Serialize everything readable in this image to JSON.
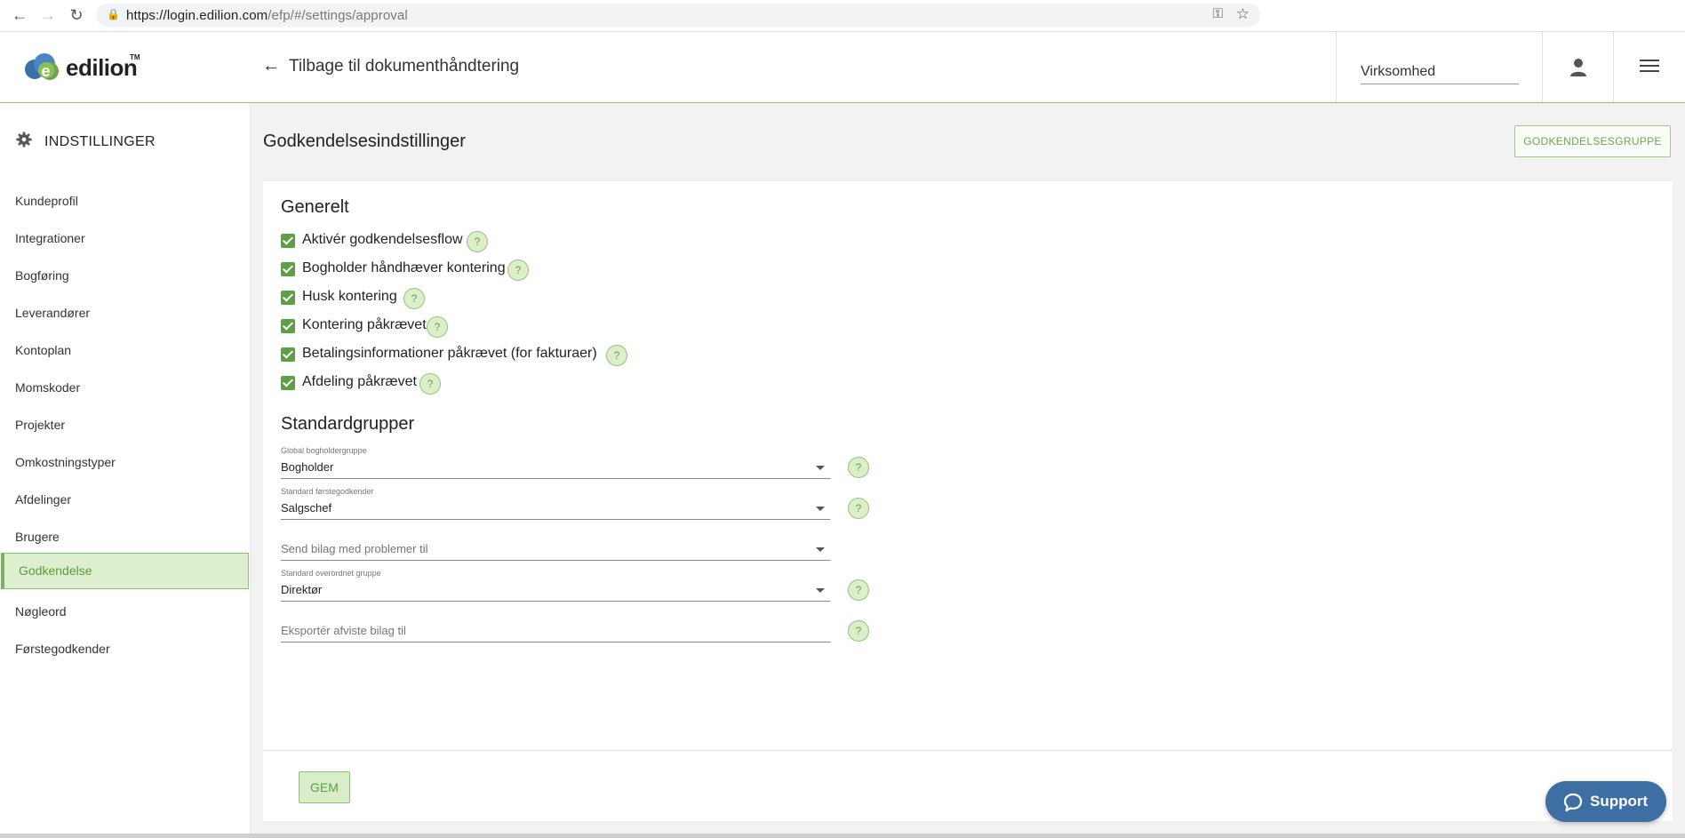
{
  "browser": {
    "url_host": "https://login.edilion.com",
    "url_path": "/efp/#/settings/approval"
  },
  "header": {
    "logo_text": "edilion",
    "logo_tm": "TM",
    "back_label": "Tilbage til dokumenthåndtering",
    "company_select": "Virksomhed"
  },
  "sidebar": {
    "title": "INDSTILLINGER",
    "items": [
      {
        "label": "Kundeprofil"
      },
      {
        "label": "Integrationer"
      },
      {
        "label": "Bogføring"
      },
      {
        "label": "Leverandører"
      },
      {
        "label": "Kontoplan"
      },
      {
        "label": "Momskoder"
      },
      {
        "label": "Projekter"
      },
      {
        "label": "Omkostningstyper"
      },
      {
        "label": "Afdelinger"
      },
      {
        "label": "Brugere"
      },
      {
        "label": "Godkendelse",
        "active": true
      },
      {
        "label": "Nøgleord"
      },
      {
        "label": "Førstegodkender"
      }
    ]
  },
  "main": {
    "title": "Godkendelsesindstillinger",
    "group_button": "GODKENDELSESGRUPPE",
    "general": {
      "title": "Generelt",
      "checkboxes": [
        {
          "label": "Aktivér godkendelsesflow",
          "checked": true
        },
        {
          "label": "Bogholder håndhæver kontering",
          "checked": true
        },
        {
          "label": "Husk kontering",
          "checked": true
        },
        {
          "label": "Kontering påkrævet",
          "checked": true
        },
        {
          "label": "Betalingsinformationer påkrævet (for fakturaer)",
          "checked": true
        },
        {
          "label": "Afdeling påkrævet",
          "checked": true
        }
      ]
    },
    "standard_groups": {
      "title": "Standardgrupper",
      "fields": [
        {
          "label": "Global bogholdergruppe",
          "value": "Bogholder"
        },
        {
          "label": "Standard førstegodkender",
          "value": "Salgschef"
        },
        {
          "placeholder": "Send bilag med problemer til"
        },
        {
          "label": "Standard overordnet gruppe",
          "value": "Direktør"
        },
        {
          "placeholder": "Eksportér afviste bilag til"
        }
      ]
    },
    "help_glyph": "?",
    "save_button": "GEM"
  },
  "support": {
    "label": "Support"
  },
  "colors": {
    "accent_green": "#5e9e46",
    "support_blue": "#3d6fa5"
  }
}
